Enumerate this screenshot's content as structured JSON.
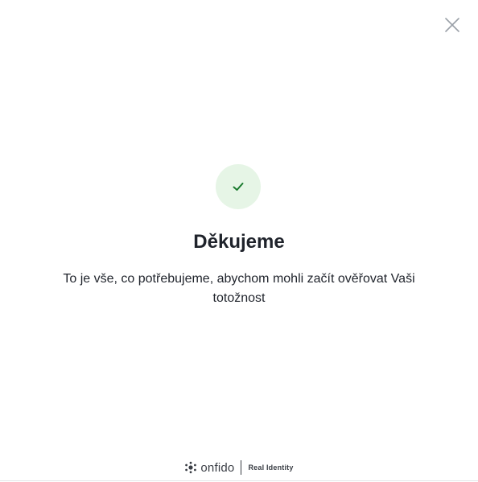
{
  "dialog": {
    "close_icon": "close-icon",
    "status_icon": "check-icon",
    "status_color": "#1a7a2e",
    "status_bg": "#e6f5e6",
    "title": "Děkujeme",
    "message": "To je vše, co potřebujeme, abychom mohli začít ověřovat Vaši totožnost"
  },
  "footer": {
    "logo_icon": "onfido-logo-icon",
    "brand": "onfido",
    "tagline": "Real Identity"
  }
}
